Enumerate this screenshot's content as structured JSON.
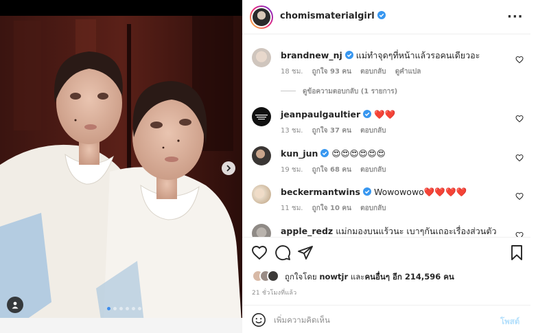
{
  "post": {
    "username": "chomismaterialgirl",
    "verified": true,
    "more_icon": "more-horizontal-icon",
    "carousel": {
      "slide_count": 6,
      "active_index": 0
    }
  },
  "comments": [
    {
      "username": "brandnew_nj",
      "verified": true,
      "text": "แม่ทำจุดๆที่หน้าแล้วรอคนเดียวอะ",
      "time": "18 ชม.",
      "likes": "ถูกใจ 93 คน",
      "reply": "ตอบกลับ",
      "translate": "ดูคำแปล",
      "replies_label": "ดูข้อความตอบกลับ (1 รายการ)"
    },
    {
      "username": "jeanpaulgaultier",
      "verified": true,
      "text": "❤️❤️",
      "time": "13 ชม.",
      "likes": "ถูกใจ 37 คน",
      "reply": "ตอบกลับ"
    },
    {
      "username": "kun_jun",
      "verified": true,
      "text": "😍😍😍😍😍😍",
      "time": "19 ชม.",
      "likes": "ถูกใจ 68 คน",
      "reply": "ตอบกลับ"
    },
    {
      "username": "beckermantwins",
      "verified": true,
      "text": "Wowowowo❤️❤️❤️❤️",
      "time": "11 ชม.",
      "likes": "ถูกใจ 10 คน",
      "reply": "ตอบกลับ"
    },
    {
      "username": "apple_redz",
      "verified": false,
      "text": "แม่กมองบนแร้วนะ เบาๆกันเถอะเรื่องส่วนตัว"
    }
  ],
  "likes": {
    "prefix": "ถูกใจโดย",
    "user": "nowtjr",
    "connector": "และ",
    "others": "คนอื่นๆ อีก 214,596 คน"
  },
  "time_ago": "21 ชั่วโมงที่แล้ว",
  "add_comment": {
    "placeholder": "เพิ่มความคิดเห็น",
    "post_label": "โพสต์"
  },
  "colors": {
    "verified": "#3897f0",
    "link_disabled": "#b2dffc",
    "meta": "#8e8e8e",
    "text": "#262626"
  }
}
